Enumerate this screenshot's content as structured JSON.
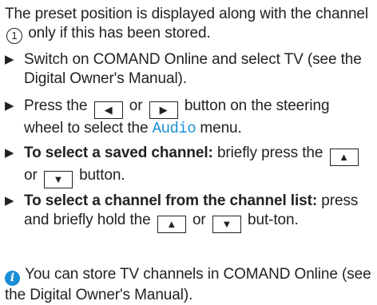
{
  "intro": {
    "before": "The preset position is displayed along with the channel",
    "marker": "1",
    "after": "only if this has been stored."
  },
  "steps": [
    {
      "arrow": "▶",
      "text": "Switch on COMAND Online and select TV (see the Digital Owner's Manual)."
    },
    {
      "arrow": "▶",
      "pre": "Press the",
      "btn1": "◀",
      "mid": "or",
      "btn2": "▶",
      "post1": "button on the steering wheel to select the",
      "menu": "Audio",
      "post2": "menu."
    },
    {
      "arrow": "▶",
      "bold": "To select a saved channel:",
      "pre": "briefly press the",
      "btn1": "▲",
      "mid": "or",
      "btn2": "▼",
      "post": "button."
    },
    {
      "arrow": "▶",
      "bold": "To select a channel from the channel list:",
      "pre": "press and briefly hold the",
      "btn1": "▲",
      "mid": "or",
      "btn2": "▼",
      "post": "but-ton."
    }
  ],
  "note": {
    "icon": "info-icon",
    "text": "You can store TV channels in COMAND Online (see the Digital Owner's Manual)."
  }
}
